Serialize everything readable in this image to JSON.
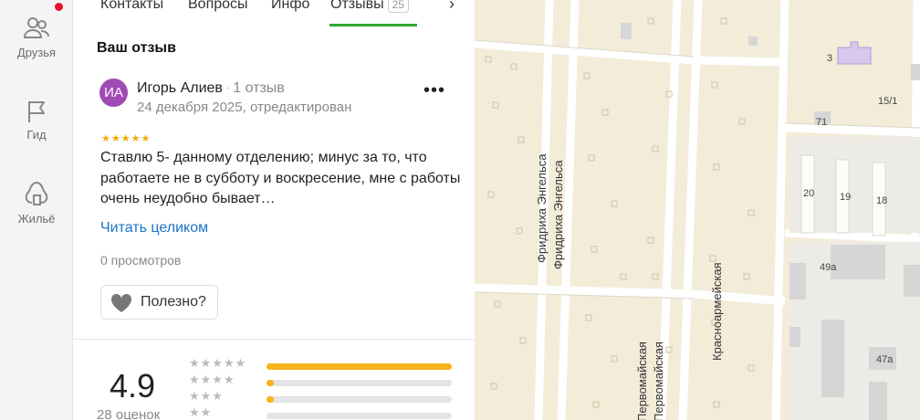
{
  "nav": {
    "friends": "Друзья",
    "guide": "Гид",
    "housing": "Жильё"
  },
  "tabs": {
    "contacts": "Контакты",
    "questions": "Вопросы",
    "info": "Инфо",
    "reviews": "Отзывы",
    "reviews_count": "25"
  },
  "review": {
    "section_title": "Ваш отзыв",
    "avatar_initials": "ИА",
    "author": "Игорь Алиев",
    "author_reviews": "1 отзыв",
    "date": "24 декабря 2025, отредактирован",
    "stars": "★★★★★",
    "text": "Ставлю 5- данному отделению; минус за то, что работаете не в субботу и воскресение, мне с работы очень неудобно бывает…",
    "read_all": "Читать целиком",
    "views": "0 просмотров",
    "useful_label": "Полезно?"
  },
  "rating": {
    "value": "4.9",
    "count_label": "28 оценок",
    "distribution": [
      {
        "stars": "★★★★★",
        "fraction": 1.0
      },
      {
        "stars": "★★★★",
        "fraction": 0.03
      },
      {
        "stars": "★★★",
        "fraction": 0.03
      },
      {
        "stars": "★★",
        "fraction": 0.0
      }
    ]
  },
  "map": {
    "streets": {
      "engels_1": "Фридриха Энгельса",
      "engels_2": "Фридриха Энгельса",
      "krasnoarmeyskaya": "Красноармейская",
      "pervomayskaya_1": "Первомайская",
      "pervomayskaya_2": "Первомайская"
    },
    "houses": {
      "h3": "3",
      "h15_1": "15/1",
      "h71": "71",
      "h20": "20",
      "h19": "19",
      "h18": "18",
      "h49a": "49а",
      "h47a": "47а"
    },
    "colors": {
      "block": "#f3ecd9",
      "road": "#ffffff",
      "building": "#e0e0e0",
      "purple_building": "#d9c7ee"
    }
  }
}
